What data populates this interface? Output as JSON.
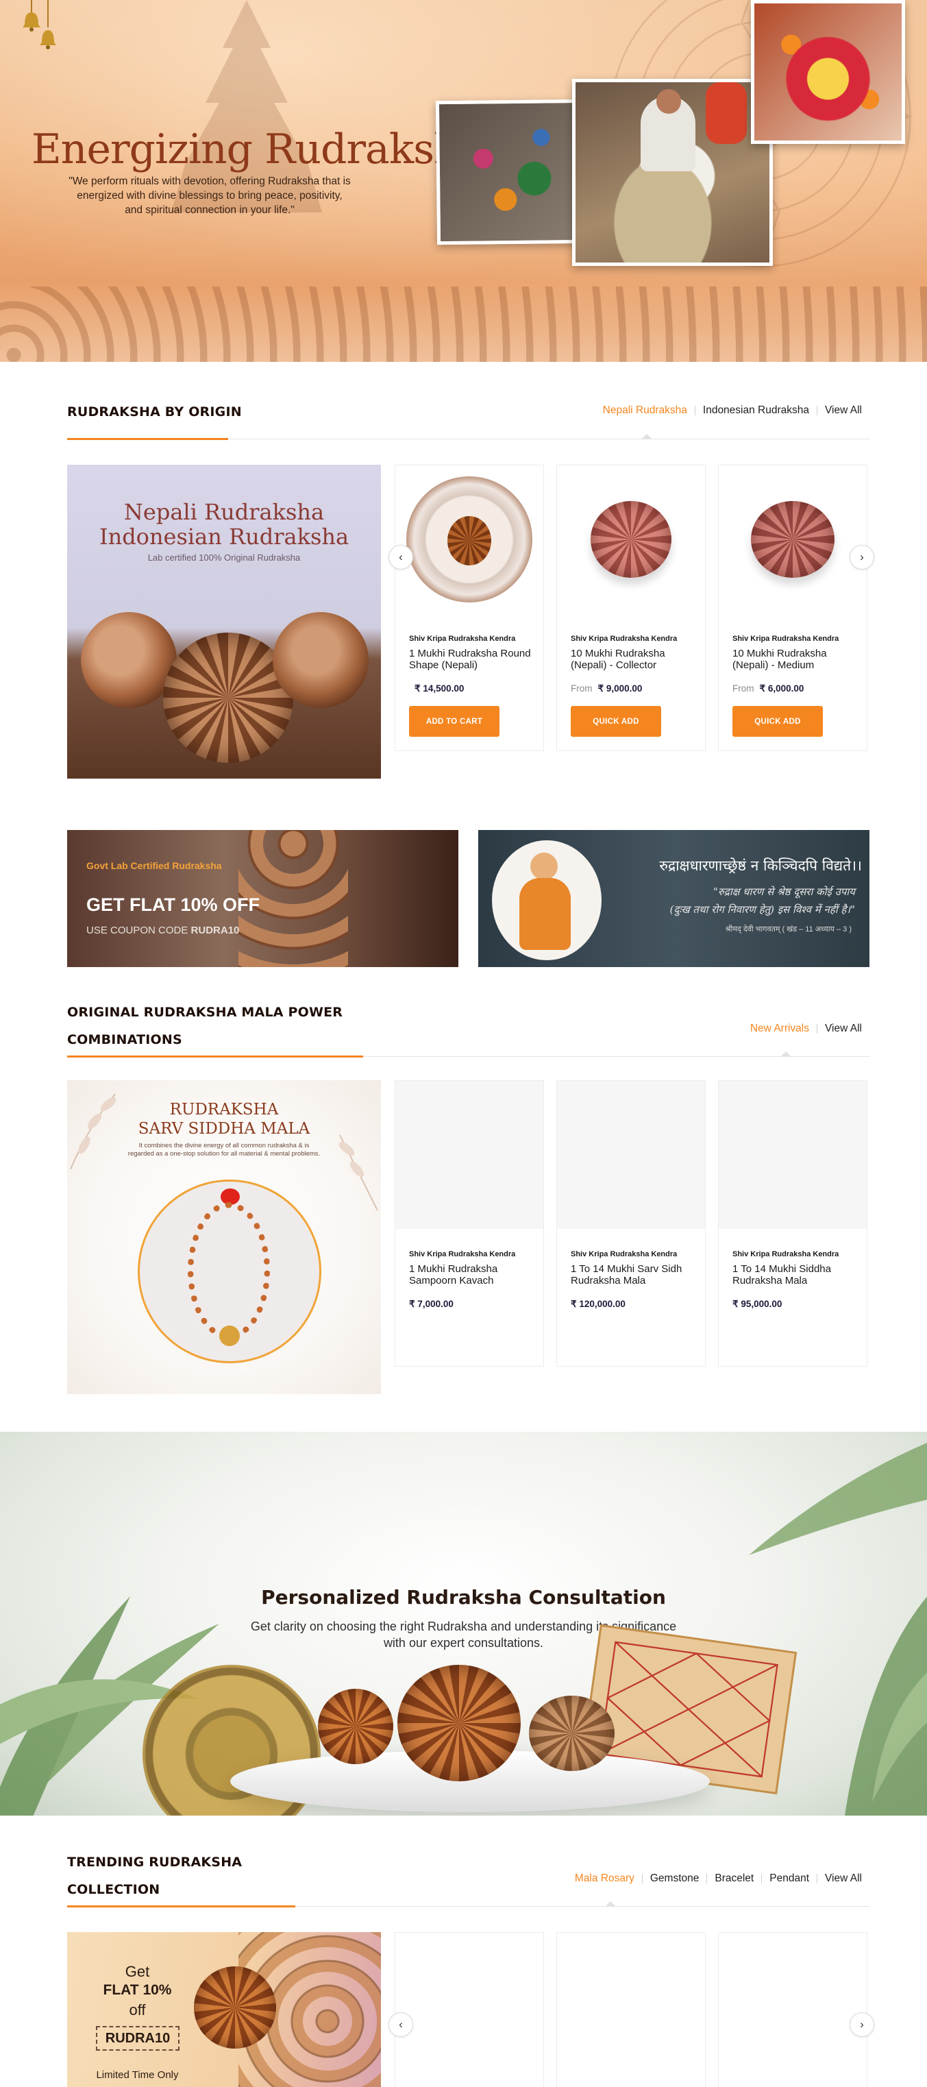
{
  "hero": {
    "title": "Energizing Rudraksha",
    "quote_line1": "\"We perform rituals with devotion, offering Rudraksha that is",
    "quote_line2": "energized with divine blessings to bring peace, positivity,",
    "quote_line3": "and spiritual connection in your life.\""
  },
  "origin_section": {
    "title": "RUDRAKSHA BY ORIGIN",
    "tabs": [
      "Nepali Rudraksha",
      "Indonesian Rudraksha",
      "View All"
    ],
    "banner": {
      "line1": "Nepali Rudraksha",
      "line2": "Indonesian Rudraksha",
      "sub": "Lab certified 100% Original Rudraksha"
    },
    "products": [
      {
        "brand": "Shiv Kripa Rudraksha Kendra",
        "name": "1 Mukhi Rudraksha Round Shape (Nepali)",
        "from": "",
        "price": "₹ 14,500.00",
        "button": "ADD TO CART"
      },
      {
        "brand": "Shiv Kripa Rudraksha Kendra",
        "name": "10 Mukhi Rudraksha (Nepali) - Collector",
        "from": "From",
        "price": "₹ 9,000.00",
        "button": "QUICK ADD"
      },
      {
        "brand": "Shiv Kripa Rudraksha Kendra",
        "name": "10 Mukhi Rudraksha (Nepali) - Medium",
        "from": "From",
        "price": "₹ 6,000.00",
        "button": "QUICK ADD"
      }
    ]
  },
  "promo": {
    "left": {
      "tag": "Govt Lab Certified Rudraksha",
      "headline": "GET FLAT 10% OFF",
      "coupon_prefix": "USE COUPON CODE ",
      "coupon_code": "RUDRA10"
    },
    "right": {
      "sanskrit": "रुद्राक्षधारणाच्छ्रेष्ठं न किञ्चिदपि विद्यते।।",
      "hindi_line1": "\"रुद्राक्ष धारण से श्रेष्ठ दूसरा कोई उपाय",
      "hindi_line2": "(दुःख तथा रोग निवारण हेतु) इस विश्व में नहीं है।\"",
      "source": "श्रीमद् देवी भागवतम् ( खंड – 11 अध्याय – 3 )"
    }
  },
  "mala_section": {
    "title_line1": "ORIGINAL RUDRAKSHA MALA POWER",
    "title_line2": "COMBINATIONS",
    "tabs": [
      "New Arrivals",
      "View All"
    ],
    "banner": {
      "line1": "RUDRAKSHA",
      "line2": "SARV SIDDHA MALA",
      "sub1": "It combines the divine energy of all common rudraksha & is",
      "sub2": "regarded as a one-stop solution for all material & mental problems."
    },
    "products": [
      {
        "brand": "Shiv Kripa Rudraksha Kendra",
        "name": "1 Mukhi Rudraksha Sampoorn Kavach",
        "price": "₹ 7,000.00"
      },
      {
        "brand": "Shiv Kripa Rudraksha Kendra",
        "name": "1 To 14 Mukhi Sarv Sidh Rudraksha Mala",
        "price": "₹ 120,000.00"
      },
      {
        "brand": "Shiv Kripa Rudraksha Kendra",
        "name": "1 To 14 Mukhi Siddha Rudraksha Mala",
        "price": "₹ 95,000.00"
      }
    ]
  },
  "consultation": {
    "title": "Personalized Rudraksha Consultation",
    "line1": "Get clarity on choosing the right Rudraksha and understanding its significance",
    "line2": "with our expert consultations."
  },
  "trending_section": {
    "title_line1": "TRENDING RUDRAKSHA",
    "title_line2": "COLLECTION",
    "tabs": [
      "Mala Rosary",
      "Gemstone",
      "Bracelet",
      "Pendant",
      "View All"
    ],
    "banner": {
      "get": "Get",
      "flat": "FLAT 10%",
      "off": "off",
      "code": "RUDRA10",
      "limited": "Limited Time Only"
    }
  },
  "colors": {
    "accent": "#f5861f",
    "hero_title": "#8e3a1a",
    "heading": "#1f0e08"
  }
}
